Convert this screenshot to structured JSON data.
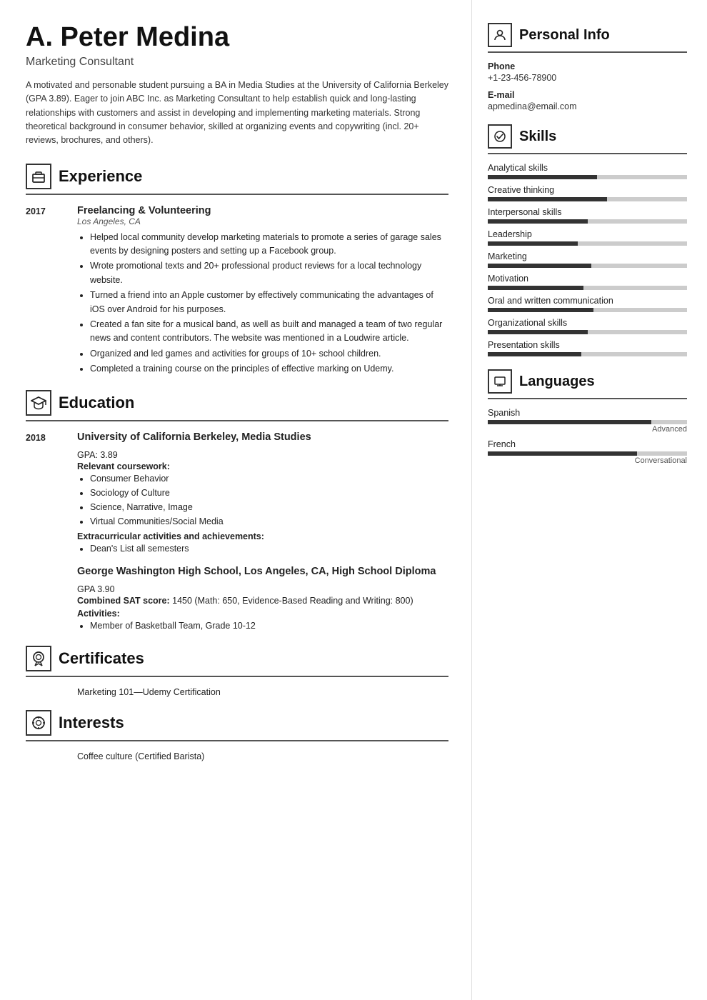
{
  "header": {
    "name": "A. Peter Medina",
    "job_title": "Marketing Consultant",
    "summary": "A motivated and personable student pursuing a BA in Media Studies at the University of California Berkeley (GPA 3.89). Eager to join ABC Inc. as Marketing Consultant to help establish quick and long-lasting relationships with customers and assist in developing and implementing marketing materials. Strong theoretical background in consumer behavior, skilled at organizing events and copywriting (incl. 20+ reviews, brochures, and others)."
  },
  "experience": {
    "section_title": "Experience",
    "entries": [
      {
        "year": "2017",
        "title": "Freelancing & Volunteering",
        "subtitle": "Los Angeles, CA",
        "bullets": [
          "Helped local community develop marketing materials to promote a series of garage sales events by designing posters and setting up a Facebook group.",
          "Wrote promotional texts and 20+ professional product reviews for a local technology website.",
          "Turned a friend into an Apple customer by effectively communicating the advantages of iOS over Android for his purposes.",
          "Created a fan site for a musical band, as well as built and managed a team of two regular news and content contributors. The website was mentioned in a Loudwire article.",
          "Organized and led games and activities for groups of 10+ school children.",
          "Completed a training course on the principles of effective marking on Udemy."
        ]
      }
    ]
  },
  "education": {
    "section_title": "Education",
    "entries": [
      {
        "year": "2018",
        "title": "University of California Berkeley, Media Studies",
        "gpa": "GPA: 3.89",
        "coursework_label": "Relevant coursework:",
        "coursework": [
          "Consumer Behavior",
          "Sociology of Culture",
          "Science, Narrative, Image",
          "Virtual Communities/Social Media"
        ],
        "activities_label": "Extracurricular activities and achievements:",
        "activities": [
          "Dean's List all semesters"
        ]
      },
      {
        "year": "",
        "title": "George Washington High School, Los Angeles, CA, High School Diploma",
        "gpa": "GPA 3.90",
        "sat_label": "Combined SAT score:",
        "sat_value": "1450 (Math: 650, Evidence-Based Reading and Writing: 800)",
        "activities_label": "Activities:",
        "activities": [
          "Member of Basketball Team, Grade 10-12"
        ]
      }
    ]
  },
  "certificates": {
    "section_title": "Certificates",
    "items": [
      "Marketing 101—Udemy Certification"
    ]
  },
  "interests": {
    "section_title": "Interests",
    "items": [
      "Coffee culture (Certified Barista)"
    ]
  },
  "personal_info": {
    "section_title": "Personal Info",
    "phone_label": "Phone",
    "phone": "+1-23-456-78900",
    "email_label": "E-mail",
    "email": "apmedina@email.com"
  },
  "skills": {
    "section_title": "Skills",
    "items": [
      {
        "name": "Analytical skills",
        "percent": 55
      },
      {
        "name": "Creative thinking",
        "percent": 60
      },
      {
        "name": "Interpersonal skills",
        "percent": 50
      },
      {
        "name": "Leadership",
        "percent": 45
      },
      {
        "name": "Marketing",
        "percent": 52
      },
      {
        "name": "Motivation",
        "percent": 48
      },
      {
        "name": "Oral and written communication",
        "percent": 53
      },
      {
        "name": "Organizational skills",
        "percent": 50
      },
      {
        "name": "Presentation skills",
        "percent": 47
      }
    ]
  },
  "languages": {
    "section_title": "Languages",
    "items": [
      {
        "name": "Spanish",
        "percent": 82,
        "level": "Advanced"
      },
      {
        "name": "French",
        "percent": 75,
        "level": "Conversational"
      }
    ]
  },
  "icons": {
    "experience": "💼",
    "education": "🎓",
    "certificates": "🏅",
    "interests": "🎯",
    "personal_info": "👤",
    "skills": "🔧",
    "languages": "🚩"
  }
}
